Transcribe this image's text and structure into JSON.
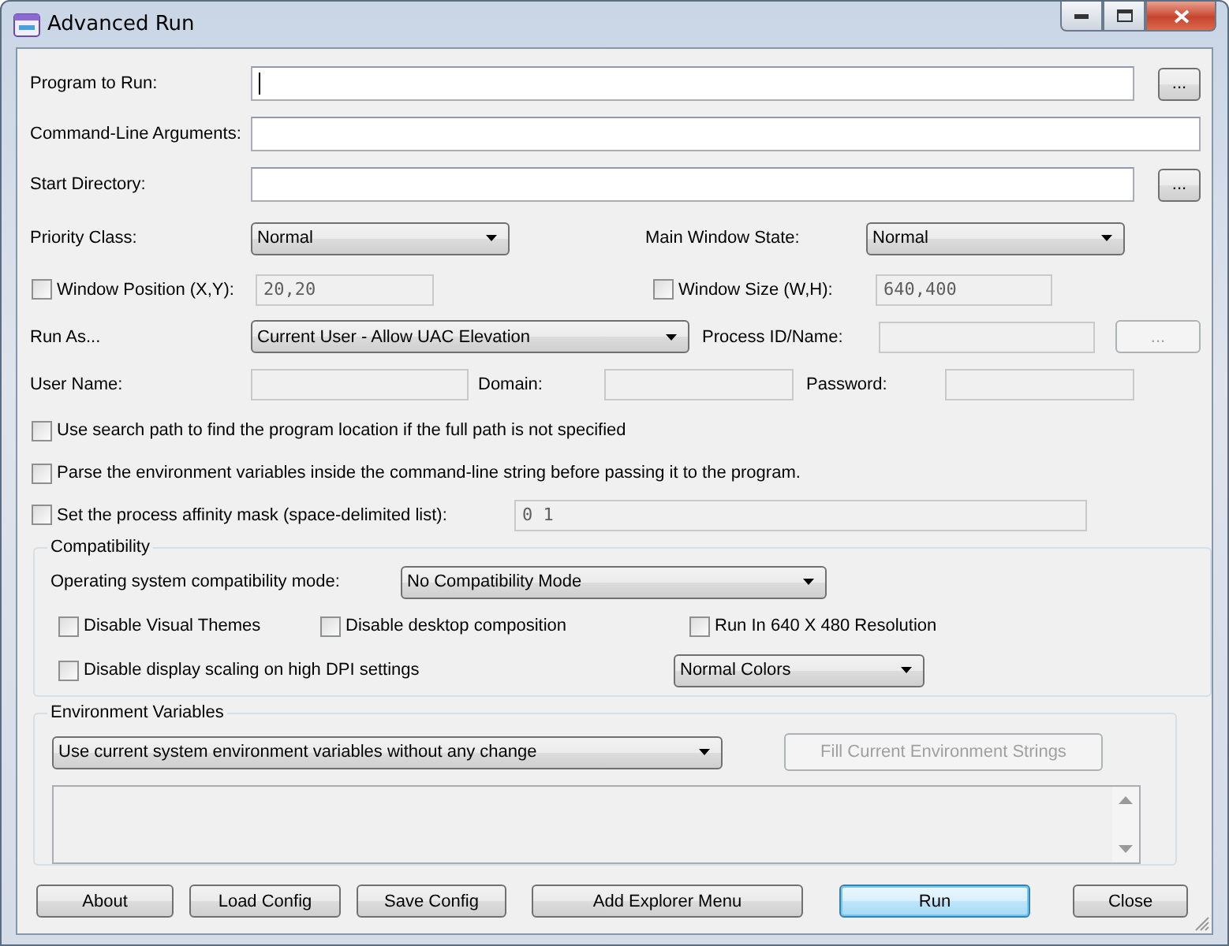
{
  "window": {
    "title": "Advanced Run"
  },
  "program_to_run": {
    "label": "Program to Run:",
    "focused": true,
    "button": "..."
  },
  "command_line": {
    "label": "Command-Line Arguments:"
  },
  "start_directory": {
    "label": "Start Directory:",
    "button": "..."
  },
  "priority_class": {
    "label": "Priority Class:",
    "value": "Normal"
  },
  "main_window_state": {
    "label": "Main Window State:",
    "value": "Normal"
  },
  "window_position": {
    "label": "Window Position (X,Y):",
    "checked": false,
    "value": "20,20",
    "disabled": true
  },
  "window_size": {
    "label": "Window Size (W,H):",
    "checked": false,
    "value": "640,400",
    "disabled": true
  },
  "run_as": {
    "label": "Run As...",
    "value": "Current User - Allow UAC Elevation"
  },
  "process_id": {
    "label": "Process ID/Name:",
    "disabled": true,
    "button": "..."
  },
  "credentials": [
    {
      "label": "User Name:",
      "disabled": true
    },
    {
      "label": "Domain:",
      "disabled": true
    },
    {
      "label": "Password:",
      "disabled": true
    }
  ],
  "options": [
    {
      "label": "Use search path to find the program location if the full path is not specified",
      "checked": false
    },
    {
      "label": "Parse the environment variables inside the command-line string before passing it to the program.",
      "checked": false
    },
    {
      "label": "Set the process affinity mask (space-delimited list):",
      "checked": false,
      "value": "0 1",
      "disabled": true
    }
  ],
  "compatibility": {
    "title": "Compatibility",
    "mode_label": "Operating system compatibility mode:",
    "mode_value": "No Compatibility Mode",
    "checkboxes": [
      {
        "label": "Disable Visual Themes",
        "checked": false
      },
      {
        "label": "Disable desktop composition",
        "checked": false
      },
      {
        "label": "Run In 640 X 480 Resolution",
        "checked": false
      },
      {
        "label": "Disable display scaling on high DPI settings",
        "checked": false
      }
    ],
    "colors_value": "Normal Colors"
  },
  "environment": {
    "title": "Environment Variables",
    "mode_value": "Use current system environment variables without any change",
    "fill_button": {
      "label": "Fill Current Environment Strings",
      "disabled": true
    }
  },
  "buttons": [
    {
      "label": "About",
      "default": false
    },
    {
      "label": "Load Config",
      "default": false
    },
    {
      "label": "Save Config",
      "default": false
    },
    {
      "label": "Add Explorer Menu",
      "default": false
    },
    {
      "label": "Run",
      "default": true
    },
    {
      "label": "Close",
      "default": false
    }
  ]
}
